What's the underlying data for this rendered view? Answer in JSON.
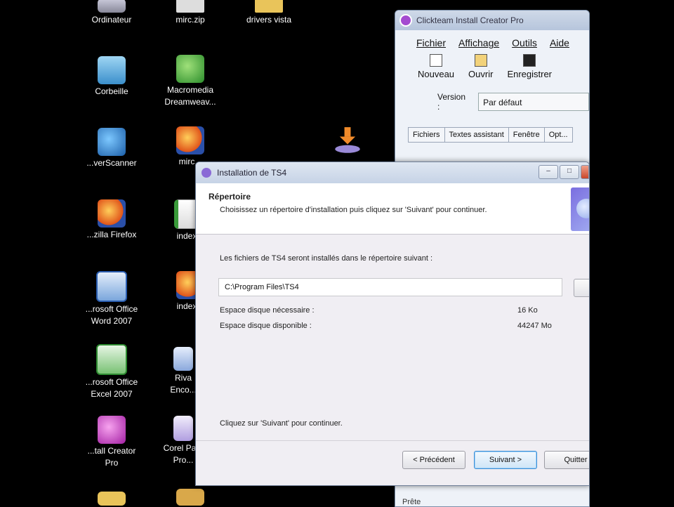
{
  "desktop": {
    "icons": [
      {
        "label": "Ordinateur",
        "icon": "computer-icon"
      },
      {
        "label": "mirc.zip",
        "icon": "zip-icon"
      },
      {
        "label": "drivers vista",
        "icon": "folder-icon"
      },
      {
        "label": "Corbeille",
        "icon": "recycle-bin-icon"
      },
      {
        "label": "Macromedia\nDreamweav...",
        "icon": "dreamweaver-icon"
      },
      {
        "label": "...verScanner",
        "icon": "scanner-icon"
      },
      {
        "label": "mirc...",
        "icon": "firefox-icon"
      },
      {
        "label": "...zilla Firefox",
        "icon": "firefox-icon"
      },
      {
        "label": "index...",
        "icon": "html-file-icon"
      },
      {
        "label": "...rosoft Office\nWord 2007",
        "icon": "word-icon"
      },
      {
        "label": "index...",
        "icon": "firefox-icon"
      },
      {
        "label": "...rosoft Office\nExcel 2007",
        "icon": "excel-icon"
      },
      {
        "label": "Riva\nEnco...",
        "icon": "riva-icon"
      },
      {
        "label": "...tall Creator\nPro",
        "icon": "install-creator-icon"
      },
      {
        "label": "Corel Pa...\nPro...",
        "icon": "corel-icon"
      }
    ]
  },
  "back_window": {
    "title": "Clickteam Install Creator Pro",
    "menu": [
      "Fichier",
      "Affichage",
      "Outils",
      "Aide"
    ],
    "toolbar": [
      "Nouveau",
      "Ouvrir",
      "Enregistrer"
    ],
    "version_label": "Version :",
    "version_value": "Par défaut",
    "tabs": [
      "Fichiers",
      "Textes assistant",
      "Fenêtre",
      "Opt..."
    ],
    "status": "Prête"
  },
  "installer": {
    "title": "Installation de TS4",
    "header_title": "Répertoire",
    "header_subtitle": "Choisissez un répertoire d'installation puis cliquez sur 'Suivant' pour continuer.",
    "intro": "Les fichiers de TS4 seront installés dans le répertoire suivant :",
    "path": "C:\\Program Files\\TS4",
    "space_required_label": "Espace disque nécessaire :",
    "space_required_value": "16 Ko",
    "space_available_label": "Espace disque disponible :",
    "space_available_value": "44247 Mo",
    "hint": "Cliquez sur 'Suivant' pour continuer.",
    "buttons": {
      "prev": "< Précédent",
      "next": "Suivant >",
      "quit": "Quitter"
    }
  }
}
